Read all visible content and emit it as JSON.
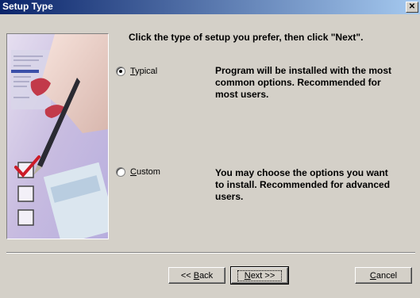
{
  "window": {
    "title": "Setup Type"
  },
  "heading": "Click the type of setup you prefer, then click \"Next\".",
  "options": [
    {
      "label_first": "T",
      "label_rest": "ypical",
      "selected": true,
      "description_lines": [
        "Program will be installed with the most",
        "common options. Recommended for",
        "most users."
      ]
    },
    {
      "label_first": "C",
      "label_rest": "ustom",
      "selected": false,
      "description_lines": [
        "You may choose the options you want",
        "to install. Recommended for advanced",
        "users."
      ]
    }
  ],
  "buttons": {
    "back": {
      "prefix": "<< ",
      "key": "B",
      "rest": "ack"
    },
    "next": {
      "key": "N",
      "rest": "ext >>"
    },
    "cancel": {
      "key": "C",
      "rest": "ancel"
    }
  },
  "colors": {
    "titlebar_start": "#0a246a",
    "titlebar_end": "#a6caf0",
    "face": "#d4d0c8",
    "check_red": "#cc1b28"
  },
  "icons": [
    "close-icon",
    "checkbox-checked-icon",
    "checkbox-empty-icon"
  ]
}
